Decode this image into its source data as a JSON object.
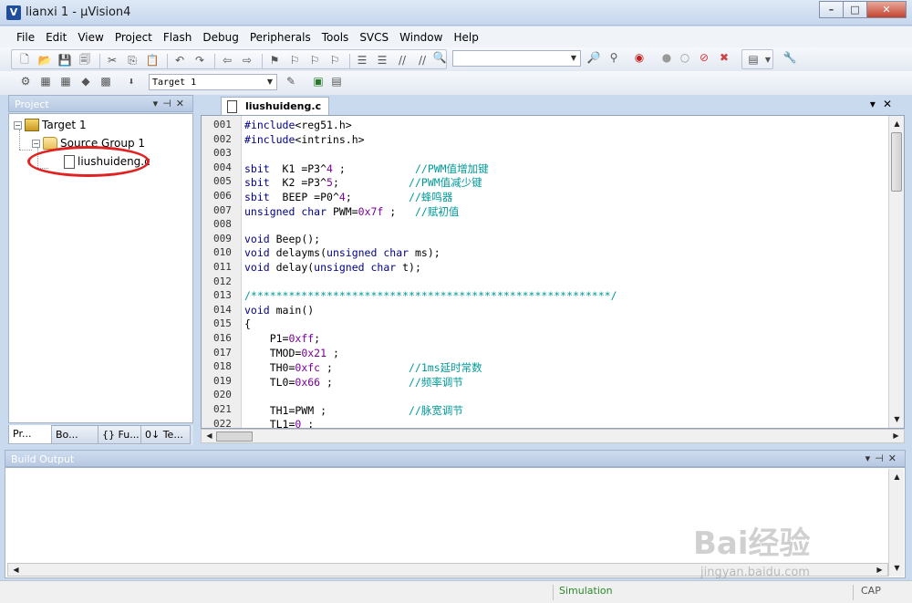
{
  "window": {
    "title": "lianxi 1  - µVision4",
    "minimize_label": "–",
    "maximize_label": "□",
    "close_label": "✕"
  },
  "menu": [
    "File",
    "Edit",
    "View",
    "Project",
    "Flash",
    "Debug",
    "Peripherals",
    "Tools",
    "SVCS",
    "Window",
    "Help"
  ],
  "toolbar2": {
    "target_select": "Target 1"
  },
  "project_panel": {
    "title": "Project",
    "target": "Target 1",
    "group": "Source Group 1",
    "file": "liushuideng.c",
    "tabs": [
      "Pr...",
      "Bo...",
      "{} Fu...",
      "0↓ Te..."
    ]
  },
  "editor": {
    "tab_label": "liushuideng.c",
    "lines": [
      {
        "n": "001",
        "t": "#include<reg51.h>"
      },
      {
        "n": "002",
        "t": "#include<intrins.h>"
      },
      {
        "n": "003",
        "t": ""
      },
      {
        "n": "004",
        "t": "sbit  K1 =P3^4 ;           //PWM值增加键"
      },
      {
        "n": "005",
        "t": "sbit  K2 =P3^5;           //PWM值减少键"
      },
      {
        "n": "006",
        "t": "sbit  BEEP =P0^4;         //蜂鸣器"
      },
      {
        "n": "007",
        "t": "unsigned char PWM=0x7f ;   //赋初值"
      },
      {
        "n": "008",
        "t": ""
      },
      {
        "n": "009",
        "t": "void Beep();"
      },
      {
        "n": "010",
        "t": "void delayms(unsigned char ms);"
      },
      {
        "n": "011",
        "t": "void delay(unsigned char t);"
      },
      {
        "n": "012",
        "t": ""
      },
      {
        "n": "013",
        "t": "/*********************************************************/"
      },
      {
        "n": "014",
        "t": "void main()"
      },
      {
        "n": "015",
        "t": "{"
      },
      {
        "n": "016",
        "t": "    P1=0xff;"
      },
      {
        "n": "017",
        "t": "    TMOD=0x21 ;"
      },
      {
        "n": "018",
        "t": "    TH0=0xfc ;            //1ms延时常数"
      },
      {
        "n": "019",
        "t": "    TL0=0x66 ;            //频率调节"
      },
      {
        "n": "020",
        "t": ""
      },
      {
        "n": "021",
        "t": "    TH1=PWM ;             //脉宽调节"
      },
      {
        "n": "022",
        "t": "    TL1=0 ;"
      }
    ]
  },
  "build_output": {
    "title": "Build Output"
  },
  "status": {
    "mode": "Simulation",
    "caps": "CAP"
  },
  "watermark": {
    "brand": "Bai经验",
    "url": "jingyan.baidu.com"
  }
}
